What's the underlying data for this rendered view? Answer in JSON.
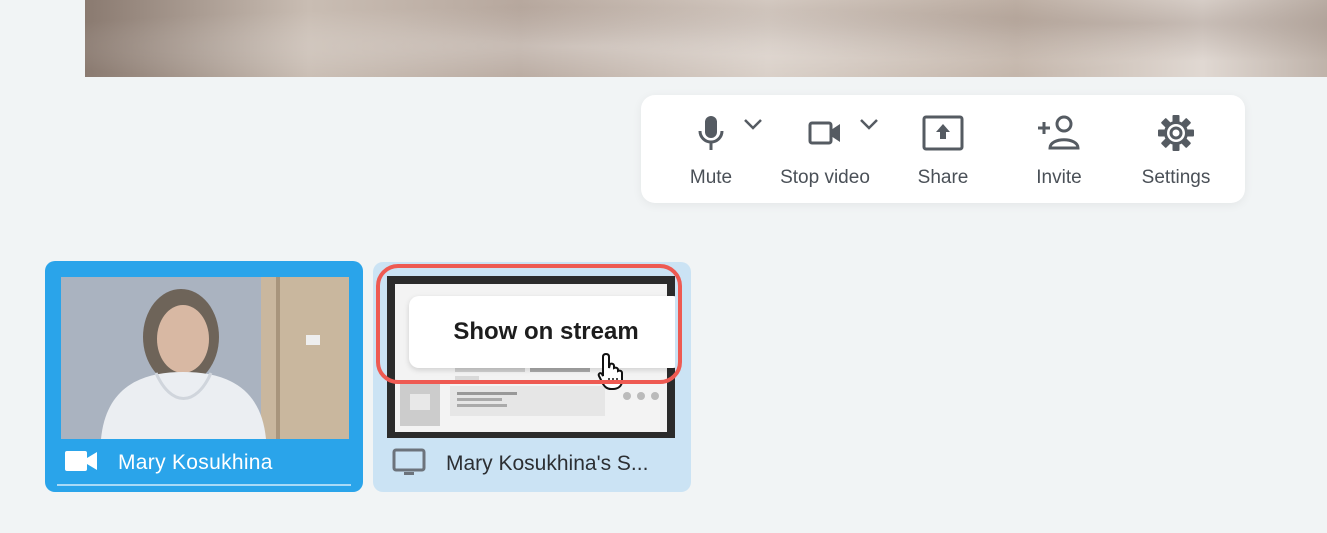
{
  "toolbar": {
    "mute_label": "Mute",
    "stop_video_label": "Stop video",
    "share_label": "Share",
    "invite_label": "Invite",
    "settings_label": "Settings"
  },
  "participants": [
    {
      "name": "Mary Kosukhina",
      "type": "camera",
      "active": true
    },
    {
      "name": "Mary Kosukhina's S...",
      "type": "screen",
      "active": false
    }
  ],
  "screen_tile": {
    "hover_label": "Show on stream"
  },
  "colors": {
    "background": "#f1f4f5",
    "active_tile": "#2aa4ea",
    "screen_tile": "#cbe3f4",
    "highlight": "#ee5a52",
    "icon": "#555b62"
  },
  "icons": {
    "mute": "microphone-icon",
    "stop_video": "video-camera-icon",
    "share": "share-screen-icon",
    "invite": "add-person-icon",
    "settings": "gear-icon",
    "cursor": "hand-pointer-icon"
  }
}
